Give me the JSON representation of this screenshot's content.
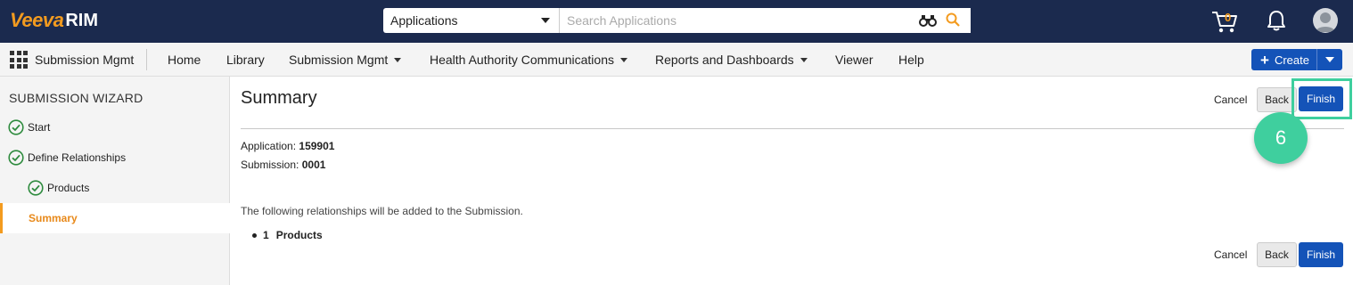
{
  "brand": {
    "veeva": "Veeva",
    "rim": "RIM",
    "accent": "#f39b1f"
  },
  "search": {
    "scope": "Applications",
    "placeholder": "Search Applications"
  },
  "cart": {
    "count": "0"
  },
  "nav": {
    "app_name": "Submission Mgmt",
    "items": [
      {
        "label": "Home",
        "dropdown": false
      },
      {
        "label": "Library",
        "dropdown": false
      },
      {
        "label": "Submission Mgmt",
        "dropdown": true
      },
      {
        "label": "Health Authority Communications",
        "dropdown": true
      },
      {
        "label": "Reports and Dashboards",
        "dropdown": true
      },
      {
        "label": "Viewer",
        "dropdown": false
      },
      {
        "label": "Help",
        "dropdown": false
      }
    ],
    "create_label": "Create"
  },
  "sidebar": {
    "title": "SUBMISSION WIZARD",
    "steps": [
      {
        "label": "Start",
        "status": "complete"
      },
      {
        "label": "Define Relationships",
        "status": "complete"
      },
      {
        "label": "Products",
        "status": "complete"
      },
      {
        "label": "Summary",
        "status": "active"
      }
    ]
  },
  "main": {
    "title": "Summary",
    "cancel_label": "Cancel",
    "back_label": "Back",
    "finish_label": "Finish",
    "application_label": "Application:",
    "application_value": "159901",
    "submission_label": "Submission:",
    "submission_value": "0001",
    "relationships_intro": "The following relationships will be added to the Submission.",
    "relationships": [
      {
        "count": "1",
        "label": "Products"
      }
    ]
  },
  "annotation": {
    "step_badge": "6",
    "color": "#3fcf9e"
  }
}
